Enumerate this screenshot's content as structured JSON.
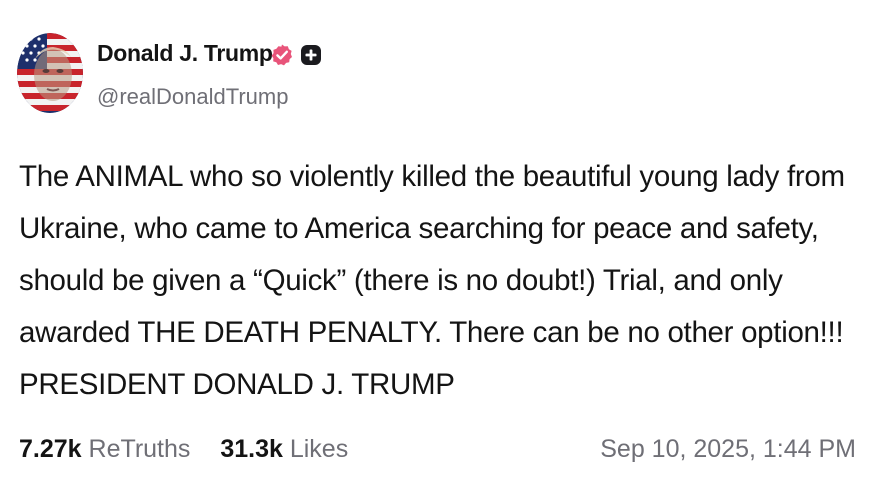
{
  "author": {
    "display_name": "Donald J. Trump",
    "handle": "@realDonaldTrump",
    "avatar_icon": "avatar-flag-portrait",
    "verified_icon": "verified-badge-icon",
    "verified_color": "#e8547a",
    "plus_icon": "plus-badge-icon"
  },
  "post": {
    "lines": [
      "The ANIMAL who so violently killed the beautiful young lady from",
      "Ukraine, who came to America searching for peace and safety,",
      "should be given a “Quick” (there is no doubt!) Trial, and only",
      "awarded THE DEATH PENALTY. There can be no other option!!!",
      "PRESIDENT DONALD J. TRUMP"
    ]
  },
  "stats": {
    "retruths_count": "7.27k",
    "retruths_label": "ReTruths",
    "likes_count": "31.3k",
    "likes_label": "Likes"
  },
  "timestamp": "Sep 10, 2025, 1:44 PM"
}
